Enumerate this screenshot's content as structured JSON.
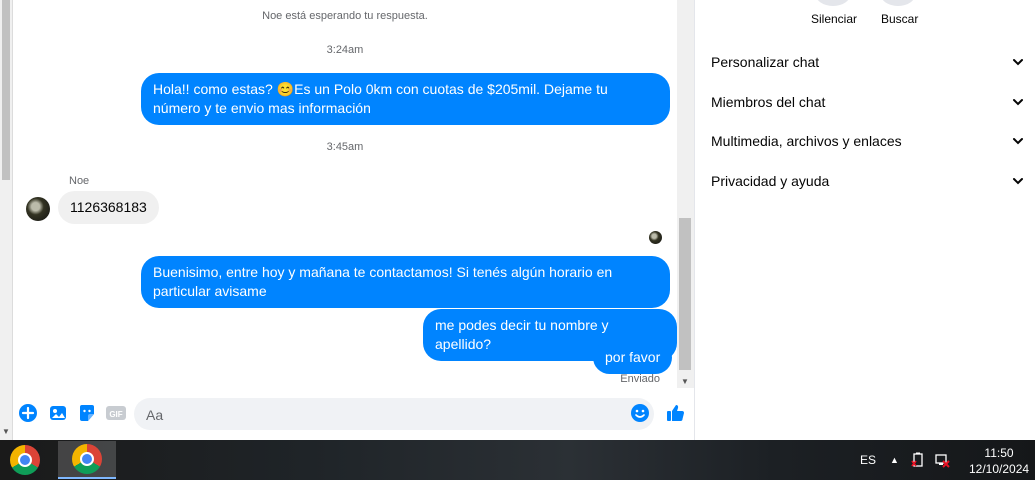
{
  "chat": {
    "waiting_notice": "Noe está esperando tu respuesta.",
    "time_1": "3:24am",
    "msg_out_1": "Hola!! como estas? 😊Es un Polo 0km con cuotas de $205mil. Dejame tu número y te envio mas información",
    "time_2": "3:45am",
    "sender_name": "Noe",
    "msg_in_1": "1126368183",
    "msg_out_2": "Buenisimo, entre hoy y mañana te contactamos! Si tenés algún horario en particular avisame",
    "msg_out_3": "me podes decir tu nombre y apellido?",
    "msg_out_4": "por favor",
    "sent_status": "Enviado",
    "bubble_color": "#0084ff"
  },
  "composer": {
    "placeholder": "Aa",
    "icons": [
      "plus-icon",
      "photo-icon",
      "sticker-icon",
      "gif-icon",
      "emoji-icon",
      "like-icon"
    ]
  },
  "side_panel": {
    "actions": [
      {
        "label": "Silenciar"
      },
      {
        "label": "Buscar"
      }
    ],
    "sections": [
      {
        "label": "Personalizar chat"
      },
      {
        "label": "Miembros del chat"
      },
      {
        "label": "Multimedia, archivos y enlaces"
      },
      {
        "label": "Privacidad y ayuda"
      }
    ]
  },
  "taskbar": {
    "language": "ES",
    "time": "11:50",
    "date": "12/10/2024"
  }
}
